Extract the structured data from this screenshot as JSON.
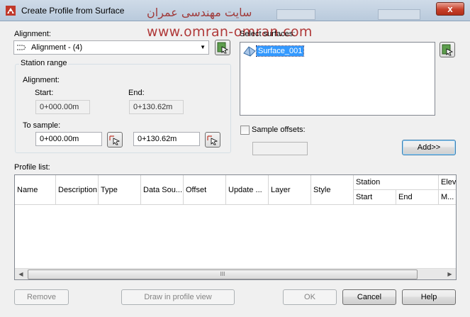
{
  "window": {
    "title": "Create Profile from Surface",
    "close_label": "x"
  },
  "watermark": {
    "persian": "سایت مهندسی عمران",
    "url": "www.omran-omran.com"
  },
  "alignment": {
    "label": "Alignment:",
    "selected": "Alignment - (4)"
  },
  "station_range": {
    "caption": "Station range",
    "alignment_label": "Alignment:",
    "start_label": "Start:",
    "end_label": "End:",
    "start_value": "0+000.00m",
    "end_value": "0+130.62m",
    "to_sample_label": "To sample:",
    "sample_start": "0+000.00m",
    "sample_end": "0+130.62m"
  },
  "surfaces": {
    "label": "Select surfaces:",
    "items": [
      "Surface_001"
    ]
  },
  "sample_offsets": {
    "label": "Sample offsets:",
    "checked": false,
    "value": ""
  },
  "add_button": "Add>>",
  "profile_list": {
    "label": "Profile list:",
    "columns": [
      "Name",
      "Description",
      "Type",
      "Data Sou...",
      "Offset",
      "Update ...",
      "Layer",
      "Style"
    ],
    "station_group": "Station",
    "station_sub": [
      "Start",
      "End"
    ],
    "elev_group": "Eleva",
    "elev_sub": "M...",
    "scroll_grip": "III"
  },
  "footer": {
    "remove": "Remove",
    "draw": "Draw in profile view",
    "ok": "OK",
    "cancel": "Cancel",
    "help": "Help"
  }
}
